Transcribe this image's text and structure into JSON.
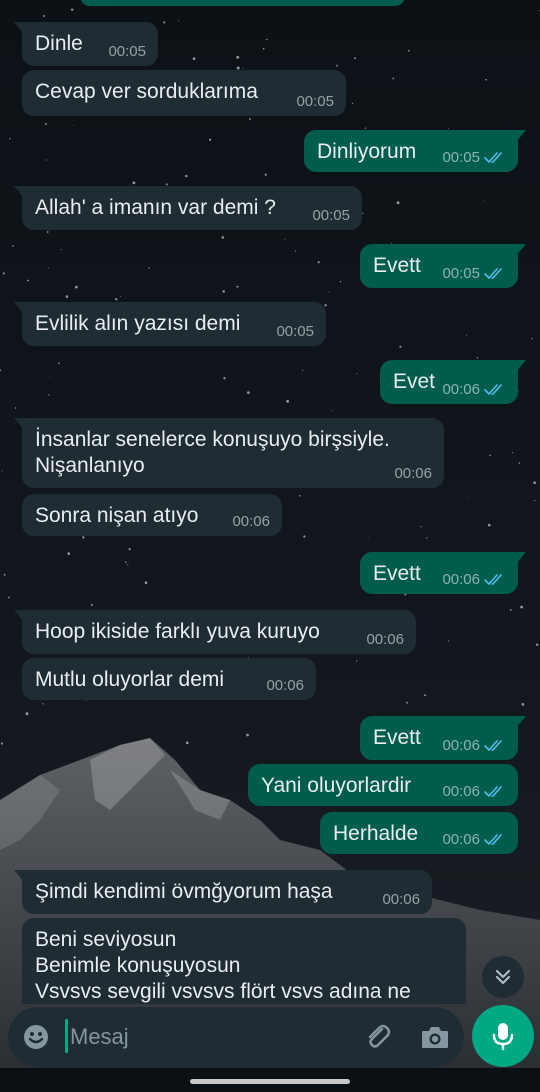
{
  "messages": [
    {
      "dir": "in",
      "text": "Dinle",
      "time": "00:05",
      "tail": true
    },
    {
      "dir": "in",
      "text": "Cevap ver sorduklarıma",
      "time": "00:05",
      "tail": false
    },
    {
      "dir": "out",
      "text": "Dinliyorum",
      "time": "00:05",
      "tail": true,
      "status": "read"
    },
    {
      "dir": "in",
      "text": "Allah' a imanın var demi ?",
      "time": "00:05",
      "tail": true
    },
    {
      "dir": "out",
      "text": "Evett",
      "time": "00:05",
      "tail": true,
      "status": "read"
    },
    {
      "dir": "in",
      "text": "Evlilik alın yazısı demi",
      "time": "00:05",
      "tail": true
    },
    {
      "dir": "out",
      "text": "Evet",
      "time": "00:06",
      "tail": true,
      "status": "read"
    },
    {
      "dir": "in",
      "text": "İnsanlar senelerce konuşuyo birşsiyle.\nNişanlanıyo",
      "time": "00:06",
      "tail": true
    },
    {
      "dir": "in",
      "text": "Sonra nişan atıyo",
      "time": "00:06",
      "tail": false
    },
    {
      "dir": "out",
      "text": "Evett",
      "time": "00:06",
      "tail": true,
      "status": "read"
    },
    {
      "dir": "in",
      "text": "Hoop ikiside farklı yuva kuruyo",
      "time": "00:06",
      "tail": true
    },
    {
      "dir": "in",
      "text": "Mutlu oluyorlar demi",
      "time": "00:06",
      "tail": false
    },
    {
      "dir": "out",
      "text": "Evett",
      "time": "00:06",
      "tail": true,
      "status": "read"
    },
    {
      "dir": "out",
      "text": "Yani oluyorlardir",
      "time": "00:06",
      "tail": false,
      "status": "read"
    },
    {
      "dir": "out",
      "text": "Herhalde",
      "time": "00:06",
      "tail": false,
      "status": "read"
    },
    {
      "dir": "in",
      "text": "Şimdi kendimi övmğyorum haşa",
      "time": "00:06",
      "tail": true
    },
    {
      "dir": "in",
      "text": "Beni seviyosun\nBenimle konuşuyosun\nVsvsvs sevgili vsvsvs flört vsvs adına ne",
      "time": "",
      "tail": false
    }
  ],
  "composer": {
    "placeholder": "Mesaj"
  },
  "icons": {
    "emoji": "emoji-icon",
    "attach": "paperclip-icon",
    "camera": "camera-icon",
    "mic": "microphone-icon",
    "scroll": "double-chevron-down-icon",
    "read": "double-check-icon"
  },
  "colors": {
    "incoming": "#1f2c34",
    "outgoing": "#005c4b",
    "accent": "#00a884",
    "read_check": "#53bdeb"
  }
}
